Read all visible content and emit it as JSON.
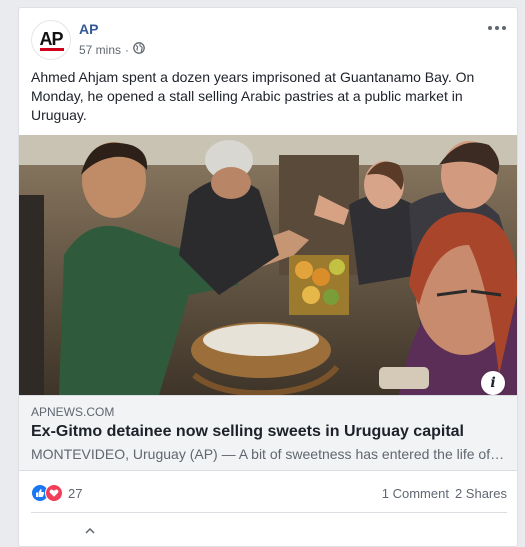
{
  "post": {
    "page_name": "AP",
    "avatar_text": "AP",
    "timestamp": "57 mins",
    "audience_icon": "globe-icon",
    "more_icon": "more-options-icon",
    "text": "Ahmed Ahjam spent a dozen years imprisoned at Guantanamo Bay. On Monday, he opened a stall selling Arabic pastries at a public market in Uruguay."
  },
  "link_preview": {
    "domain": "APNEWS.COM",
    "title": "Ex-Gitmo detainee now selling sweets in Uruguay capital",
    "description": "MONTEVIDEO, Uruguay (AP) — A bit of sweetness has entered the life of ...",
    "info_icon": "info-icon",
    "info_label": "i"
  },
  "stats": {
    "reaction_icons": [
      "like-icon",
      "love-icon"
    ],
    "reaction_count": "27",
    "comments": "1 Comment",
    "shares": "2 Shares"
  },
  "colors": {
    "page_bg": "#e9ebee",
    "link_blue": "#365899",
    "ap_red": "#d0021b",
    "like_blue": "#1877f2",
    "love_red": "#f33e58"
  }
}
